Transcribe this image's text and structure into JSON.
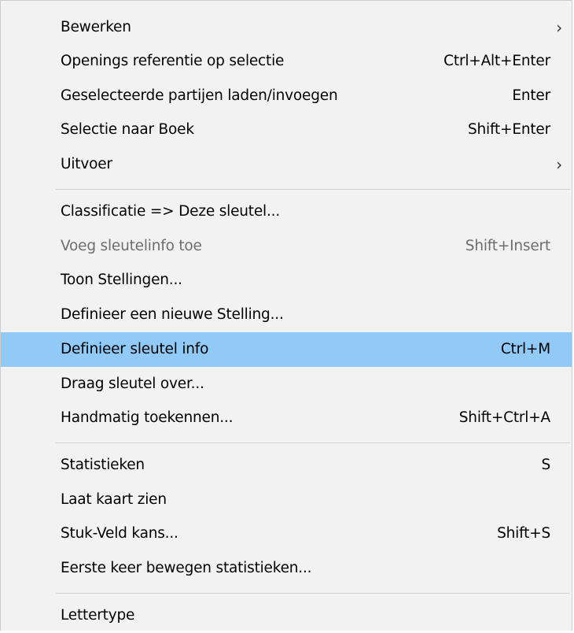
{
  "menu": {
    "items": [
      {
        "label": "Bewerken",
        "shortcut": "",
        "arrow": "›"
      },
      {
        "label": "Openings referentie op selectie",
        "shortcut": "Ctrl+Alt+Enter",
        "arrow": ""
      },
      {
        "label": "Geselecteerde partijen laden/invoegen",
        "shortcut": "Enter",
        "arrow": ""
      },
      {
        "label": "Selectie naar Boek",
        "shortcut": "Shift+Enter",
        "arrow": ""
      },
      {
        "label": "Uitvoer",
        "shortcut": "",
        "arrow": "›"
      },
      {
        "label": "Classificatie => Deze sleutel...",
        "shortcut": "",
        "arrow": ""
      },
      {
        "label": "Voeg sleutelinfo toe",
        "shortcut": "Shift+Insert",
        "arrow": "",
        "disabled": true
      },
      {
        "label": "Toon Stellingen...",
        "shortcut": "",
        "arrow": ""
      },
      {
        "label": "Definieer een nieuwe Stelling...",
        "shortcut": "",
        "arrow": ""
      },
      {
        "label": "Definieer sleutel info",
        "shortcut": "Ctrl+M",
        "arrow": "",
        "highlighted": true
      },
      {
        "label": "Draag sleutel over...",
        "shortcut": "",
        "arrow": ""
      },
      {
        "label": "Handmatig toekennen...",
        "shortcut": "Shift+Ctrl+A",
        "arrow": ""
      },
      {
        "label": "Statistieken",
        "shortcut": "S",
        "arrow": ""
      },
      {
        "label": "Laat kaart zien",
        "shortcut": "",
        "arrow": ""
      },
      {
        "label": "Stuk-Veld kans...",
        "shortcut": "Shift+S",
        "arrow": ""
      },
      {
        "label": "Eerste keer bewegen statistieken...",
        "shortcut": "",
        "arrow": ""
      },
      {
        "label": "Lettertype",
        "shortcut": "",
        "arrow": ""
      }
    ]
  },
  "colors": {
    "highlight": "#91c9f7",
    "disabled_text": "#6d6d6d",
    "background": "#f2f2f2"
  }
}
